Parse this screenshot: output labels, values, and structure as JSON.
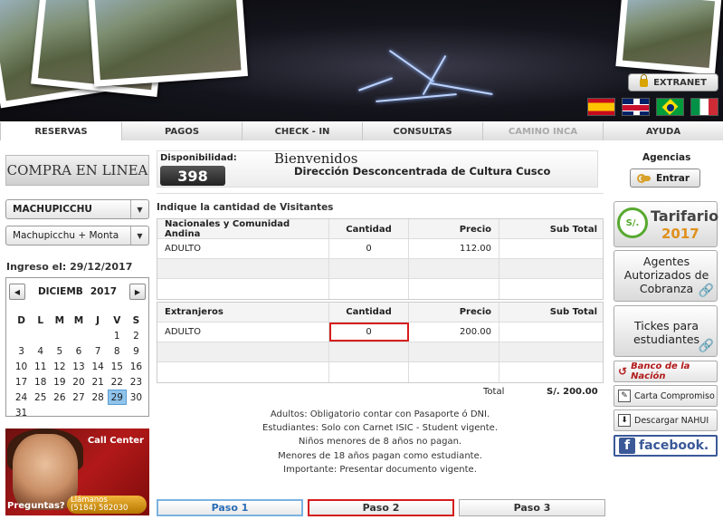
{
  "header": {
    "extranet_label": "EXTRANET",
    "flags": [
      "spain-flag",
      "uk-flag",
      "brazil-flag",
      "italy-flag"
    ]
  },
  "nav": {
    "tabs": [
      {
        "label": "RESERVAS",
        "state": "active"
      },
      {
        "label": "PAGOS",
        "state": "normal"
      },
      {
        "label": "CHECK - IN",
        "state": "normal"
      },
      {
        "label": "CONSULTAS",
        "state": "normal"
      },
      {
        "label": "CAMINO INCA",
        "state": "disabled"
      },
      {
        "label": "AYUDA",
        "state": "normal"
      }
    ]
  },
  "left": {
    "brand": "COMPRA EN LINEA",
    "site_select": "MACHUPICCHU",
    "route_select": "Machupicchu + Monta",
    "ingreso_label": "Ingreso el:",
    "ingreso_date": "29/12/2017",
    "calendar": {
      "month": "DICIEMB",
      "year": "2017",
      "weekdays": [
        "D",
        "L",
        "M",
        "M",
        "J",
        "V",
        "S"
      ],
      "leading_blanks": 5,
      "days": 31,
      "selected_day": 29
    },
    "callcenter": {
      "title": "Call Center",
      "preguntas": "Preguntas?",
      "phone_label": "Llámanos",
      "phone_number": "(5184) 582030"
    }
  },
  "center": {
    "disponibilidad_label": "Disponibilidad:",
    "disponibilidad_value": "398",
    "welcome": "Bienvenidos",
    "direccion": "Dirección Desconcentrada de Cultura Cusco",
    "indique": "Indique la cantidad de Visitantes",
    "table_nacionales": {
      "headers": [
        "Nacionales y Comunidad Andina",
        "Cantidad",
        "Precio",
        "Sub Total"
      ],
      "rows": [
        [
          "ADULTO",
          "0",
          "112.00",
          ""
        ]
      ]
    },
    "table_extranjeros": {
      "headers": [
        "Extranjeros",
        "Cantidad",
        "Precio",
        "Sub Total"
      ],
      "rows": [
        [
          "ADULTO",
          "0",
          "200.00",
          ""
        ]
      ]
    },
    "total_label": "Total",
    "total_value": "S/. 200.00",
    "notes": [
      "Adultos: Obligatorio contar con Pasaporte ó DNI.",
      "Estudiantes: Solo con Carnet ISIC - Student vigente.",
      "Niños menores de 8 años no pagan.",
      "Menores de 18 años pagan como estudiante.",
      "Importante: Presentar documento vigente."
    ],
    "steps": [
      "Paso 1",
      "Paso 2",
      "Paso 3"
    ]
  },
  "right": {
    "agencias_label": "Agencias",
    "entrar_label": "Entrar",
    "tarifario_icon_text": "S/.",
    "tarifario_title": "Tarifario",
    "tarifario_year": "2017",
    "agentes_text": "Agentes Autorizados de Cobranza",
    "tickes_text": "Tickes para estudiantes",
    "banco_text": "Banco de la Nación",
    "carta_text": "Carta Compromiso",
    "descargar_text": "Descargar NAHUI",
    "facebook_text": "facebook."
  }
}
